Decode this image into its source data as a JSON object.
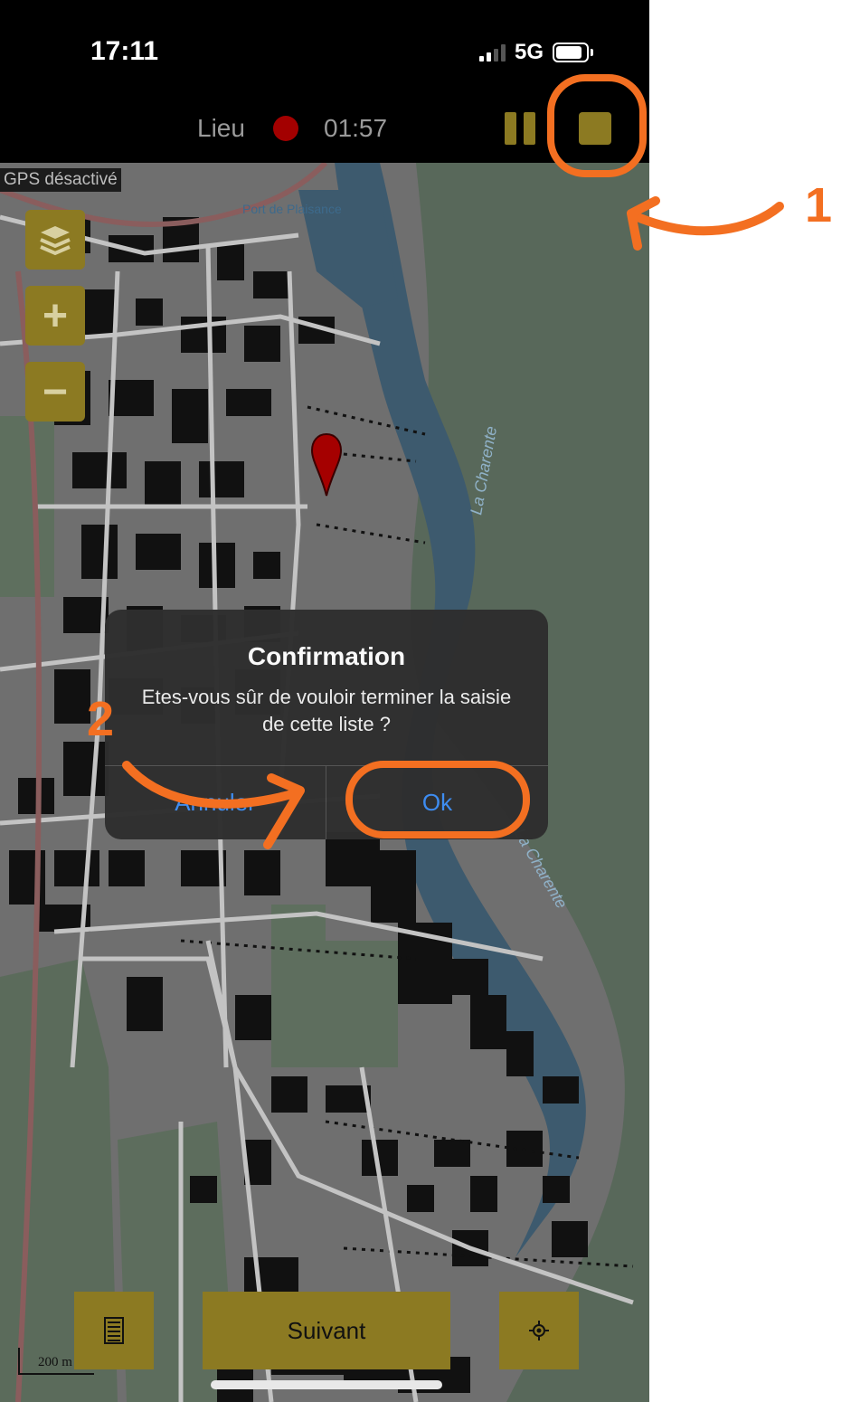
{
  "status_bar": {
    "time": "17:11",
    "network": "5G"
  },
  "top_bar": {
    "place_label": "Lieu",
    "timer": "01:57",
    "pause_icon": "pause-icon",
    "stop_icon": "stop-icon",
    "accent_color": "#8c7a22",
    "record_color": "#a30000"
  },
  "map": {
    "gps_status": "GPS désactivé",
    "labels": {
      "harbor": "Port de Plaisance",
      "river_1": "La Charente",
      "river_2": "La Charente"
    },
    "controls": {
      "layers_icon": "layers-icon",
      "zoom_in": "+",
      "zoom_out": "−"
    },
    "scale": "200 m"
  },
  "dialog": {
    "title": "Confirmation",
    "message": "Etes-vous sûr de vouloir terminer la saisie de cette liste ?",
    "cancel_label": "Annuler",
    "ok_label": "Ok"
  },
  "bottom_bar": {
    "list_icon": "list-icon",
    "next_label": "Suivant",
    "locate_icon": "locate-icon"
  },
  "annotations": {
    "step_1": "1",
    "step_2": "2",
    "highlight_color": "#f36f21"
  }
}
